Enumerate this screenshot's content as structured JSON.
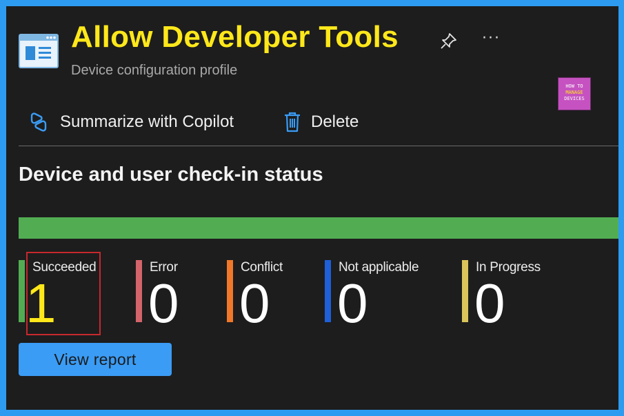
{
  "header": {
    "title": "Allow Developer Tools",
    "subtitle": "Device configuration profile",
    "icons": [
      "profile-window-icon",
      "pin-icon",
      "more-icon"
    ],
    "more_label": "···"
  },
  "logo": {
    "line1": "HOW TO",
    "line2": "MANAGE",
    "line3": "DEVICES"
  },
  "toolbar": {
    "copilot_label": "Summarize with Copilot",
    "delete_label": "Delete"
  },
  "section": {
    "title": "Device and user check-in status"
  },
  "status_bar": {
    "succeeded_fraction": 1.0,
    "color": "#52ad52"
  },
  "stats": [
    {
      "label": "Succeeded",
      "value": "1",
      "color": "#52ad52"
    },
    {
      "label": "Error",
      "value": "0",
      "color": "#d4646b"
    },
    {
      "label": "Conflict",
      "value": "0",
      "color": "#f07828"
    },
    {
      "label": "Not applicable",
      "value": "0",
      "color": "#1f5fd8"
    },
    {
      "label": "In Progress",
      "value": "0",
      "color": "#d9c45a"
    }
  ],
  "actions": {
    "view_report_label": "View report"
  },
  "colors": {
    "title": "#ffe81a",
    "accent_button": "#3a9cf5",
    "highlight_border": "#c8282e",
    "background": "#1d1d1d"
  }
}
